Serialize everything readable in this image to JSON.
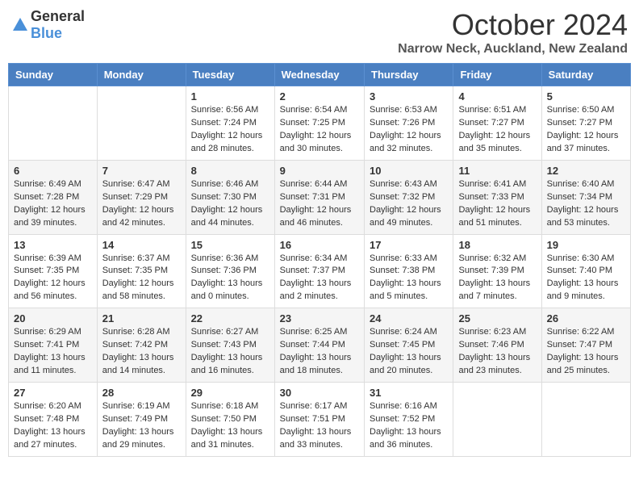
{
  "logo": {
    "general": "General",
    "blue": "Blue"
  },
  "header": {
    "month": "October 2024",
    "location": "Narrow Neck, Auckland, New Zealand"
  },
  "weekdays": [
    "Sunday",
    "Monday",
    "Tuesday",
    "Wednesday",
    "Thursday",
    "Friday",
    "Saturday"
  ],
  "weeks": [
    [
      {
        "day": "",
        "info": ""
      },
      {
        "day": "",
        "info": ""
      },
      {
        "day": "1",
        "info": "Sunrise: 6:56 AM\nSunset: 7:24 PM\nDaylight: 12 hours and 28 minutes."
      },
      {
        "day": "2",
        "info": "Sunrise: 6:54 AM\nSunset: 7:25 PM\nDaylight: 12 hours and 30 minutes."
      },
      {
        "day": "3",
        "info": "Sunrise: 6:53 AM\nSunset: 7:26 PM\nDaylight: 12 hours and 32 minutes."
      },
      {
        "day": "4",
        "info": "Sunrise: 6:51 AM\nSunset: 7:27 PM\nDaylight: 12 hours and 35 minutes."
      },
      {
        "day": "5",
        "info": "Sunrise: 6:50 AM\nSunset: 7:27 PM\nDaylight: 12 hours and 37 minutes."
      }
    ],
    [
      {
        "day": "6",
        "info": "Sunrise: 6:49 AM\nSunset: 7:28 PM\nDaylight: 12 hours and 39 minutes."
      },
      {
        "day": "7",
        "info": "Sunrise: 6:47 AM\nSunset: 7:29 PM\nDaylight: 12 hours and 42 minutes."
      },
      {
        "day": "8",
        "info": "Sunrise: 6:46 AM\nSunset: 7:30 PM\nDaylight: 12 hours and 44 minutes."
      },
      {
        "day": "9",
        "info": "Sunrise: 6:44 AM\nSunset: 7:31 PM\nDaylight: 12 hours and 46 minutes."
      },
      {
        "day": "10",
        "info": "Sunrise: 6:43 AM\nSunset: 7:32 PM\nDaylight: 12 hours and 49 minutes."
      },
      {
        "day": "11",
        "info": "Sunrise: 6:41 AM\nSunset: 7:33 PM\nDaylight: 12 hours and 51 minutes."
      },
      {
        "day": "12",
        "info": "Sunrise: 6:40 AM\nSunset: 7:34 PM\nDaylight: 12 hours and 53 minutes."
      }
    ],
    [
      {
        "day": "13",
        "info": "Sunrise: 6:39 AM\nSunset: 7:35 PM\nDaylight: 12 hours and 56 minutes."
      },
      {
        "day": "14",
        "info": "Sunrise: 6:37 AM\nSunset: 7:35 PM\nDaylight: 12 hours and 58 minutes."
      },
      {
        "day": "15",
        "info": "Sunrise: 6:36 AM\nSunset: 7:36 PM\nDaylight: 13 hours and 0 minutes."
      },
      {
        "day": "16",
        "info": "Sunrise: 6:34 AM\nSunset: 7:37 PM\nDaylight: 13 hours and 2 minutes."
      },
      {
        "day": "17",
        "info": "Sunrise: 6:33 AM\nSunset: 7:38 PM\nDaylight: 13 hours and 5 minutes."
      },
      {
        "day": "18",
        "info": "Sunrise: 6:32 AM\nSunset: 7:39 PM\nDaylight: 13 hours and 7 minutes."
      },
      {
        "day": "19",
        "info": "Sunrise: 6:30 AM\nSunset: 7:40 PM\nDaylight: 13 hours and 9 minutes."
      }
    ],
    [
      {
        "day": "20",
        "info": "Sunrise: 6:29 AM\nSunset: 7:41 PM\nDaylight: 13 hours and 11 minutes."
      },
      {
        "day": "21",
        "info": "Sunrise: 6:28 AM\nSunset: 7:42 PM\nDaylight: 13 hours and 14 minutes."
      },
      {
        "day": "22",
        "info": "Sunrise: 6:27 AM\nSunset: 7:43 PM\nDaylight: 13 hours and 16 minutes."
      },
      {
        "day": "23",
        "info": "Sunrise: 6:25 AM\nSunset: 7:44 PM\nDaylight: 13 hours and 18 minutes."
      },
      {
        "day": "24",
        "info": "Sunrise: 6:24 AM\nSunset: 7:45 PM\nDaylight: 13 hours and 20 minutes."
      },
      {
        "day": "25",
        "info": "Sunrise: 6:23 AM\nSunset: 7:46 PM\nDaylight: 13 hours and 23 minutes."
      },
      {
        "day": "26",
        "info": "Sunrise: 6:22 AM\nSunset: 7:47 PM\nDaylight: 13 hours and 25 minutes."
      }
    ],
    [
      {
        "day": "27",
        "info": "Sunrise: 6:20 AM\nSunset: 7:48 PM\nDaylight: 13 hours and 27 minutes."
      },
      {
        "day": "28",
        "info": "Sunrise: 6:19 AM\nSunset: 7:49 PM\nDaylight: 13 hours and 29 minutes."
      },
      {
        "day": "29",
        "info": "Sunrise: 6:18 AM\nSunset: 7:50 PM\nDaylight: 13 hours and 31 minutes."
      },
      {
        "day": "30",
        "info": "Sunrise: 6:17 AM\nSunset: 7:51 PM\nDaylight: 13 hours and 33 minutes."
      },
      {
        "day": "31",
        "info": "Sunrise: 6:16 AM\nSunset: 7:52 PM\nDaylight: 13 hours and 36 minutes."
      },
      {
        "day": "",
        "info": ""
      },
      {
        "day": "",
        "info": ""
      }
    ]
  ]
}
